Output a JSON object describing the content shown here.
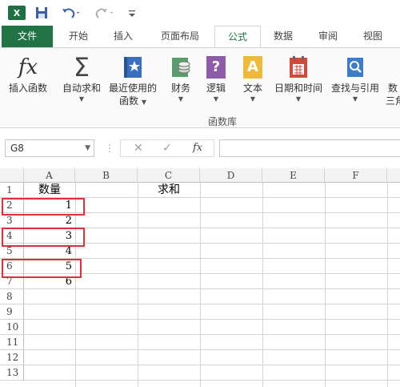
{
  "qat": {
    "app_logo": "X",
    "save_icon": "save-icon",
    "undo_icon": "undo-icon",
    "redo_icon": "redo-icon",
    "customize_icon": "customize-icon"
  },
  "tabs": [
    {
      "label": "文件"
    },
    {
      "label": "开始"
    },
    {
      "label": "插入"
    },
    {
      "label": "页面布局"
    },
    {
      "label": "公式"
    },
    {
      "label": "数据"
    },
    {
      "label": "审阅"
    },
    {
      "label": "视图"
    }
  ],
  "ribbon": {
    "insert_function": "插入函数",
    "insert_function_icon": "fx",
    "autosum": "自动求和",
    "autosum_icon": "Σ",
    "recent_line1": "最近使用的",
    "recent_line2": "函数",
    "financial": "财务",
    "logical": "逻辑",
    "logical_glyph": "?",
    "text": "文本",
    "text_glyph": "A",
    "datetime": "日期和时间",
    "lookup": "查找与引用",
    "math_partial_1": "数",
    "math_partial_2": "三角",
    "group_label": "函数库"
  },
  "formula_bar": {
    "name_box": "G8",
    "cancel_glyph": "✕",
    "enter_glyph": "✓",
    "fx_glyph": "fx",
    "formula": ""
  },
  "grid": {
    "columns": [
      "A",
      "B",
      "C",
      "D",
      "E",
      "F"
    ],
    "rows": [
      "1",
      "2",
      "3",
      "4",
      "5",
      "6",
      "7",
      "8",
      "9",
      "10",
      "11",
      "12",
      "13"
    ],
    "cells": {
      "A1": "数量",
      "C1": "求和",
      "A2": "1",
      "A3": "2",
      "A4": "3",
      "A5": "4",
      "A6": "5",
      "A7": "6"
    }
  },
  "colors": {
    "excel_green": "#217346",
    "highlight_red": "#e0303a"
  }
}
